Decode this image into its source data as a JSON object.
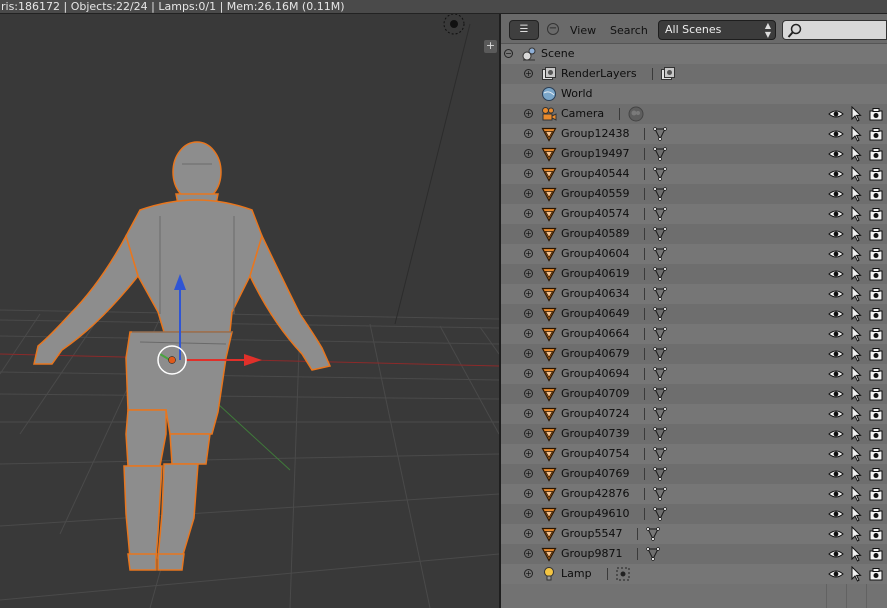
{
  "status_bar": {
    "text": "ris:186172 | Objects:22/24 | Lamps:0/1 | Mem:26.16M (0.11M)"
  },
  "viewport": {
    "plus_label": "+"
  },
  "outliner": {
    "header": {
      "editor_type_label": "☰",
      "collapse_label": "−",
      "view_menu": "View",
      "search_menu": "Search",
      "display_mode": "All Scenes",
      "search_placeholder": ""
    },
    "rows": [
      {
        "label": "Scene",
        "icon": "scene-icon",
        "level": 0,
        "expander": "minus",
        "data_icon": null,
        "restrict": false
      },
      {
        "label": "RenderLayers",
        "icon": "renderlayers-icon",
        "level": 1,
        "expander": "plus",
        "data_icon": "renderlayer-icon",
        "restrict": false
      },
      {
        "label": "World",
        "icon": "world-icon",
        "level": 1,
        "expander": null,
        "data_icon": null,
        "restrict": false
      },
      {
        "label": "Camera",
        "icon": "camera-object-icon",
        "level": 1,
        "expander": "plus",
        "data_icon": "camera-data-icon",
        "restrict": true
      },
      {
        "label": "Group12438",
        "icon": "mesh-object-icon",
        "level": 1,
        "expander": "plus",
        "data_icon": "mesh-data-icon",
        "restrict": true
      },
      {
        "label": "Group19497",
        "icon": "mesh-object-icon",
        "level": 1,
        "expander": "plus",
        "data_icon": "mesh-data-icon",
        "restrict": true
      },
      {
        "label": "Group40544",
        "icon": "mesh-object-icon",
        "level": 1,
        "expander": "plus",
        "data_icon": "mesh-data-icon",
        "restrict": true
      },
      {
        "label": "Group40559",
        "icon": "mesh-object-icon",
        "level": 1,
        "expander": "plus",
        "data_icon": "mesh-data-icon",
        "restrict": true
      },
      {
        "label": "Group40574",
        "icon": "mesh-object-icon",
        "level": 1,
        "expander": "plus",
        "data_icon": "mesh-data-icon",
        "restrict": true
      },
      {
        "label": "Group40589",
        "icon": "mesh-object-icon",
        "level": 1,
        "expander": "plus",
        "data_icon": "mesh-data-icon",
        "restrict": true
      },
      {
        "label": "Group40604",
        "icon": "mesh-object-icon",
        "level": 1,
        "expander": "plus",
        "data_icon": "mesh-data-icon",
        "restrict": true
      },
      {
        "label": "Group40619",
        "icon": "mesh-object-icon",
        "level": 1,
        "expander": "plus",
        "data_icon": "mesh-data-icon",
        "restrict": true
      },
      {
        "label": "Group40634",
        "icon": "mesh-object-icon",
        "level": 1,
        "expander": "plus",
        "data_icon": "mesh-data-icon",
        "restrict": true
      },
      {
        "label": "Group40649",
        "icon": "mesh-object-icon",
        "level": 1,
        "expander": "plus",
        "data_icon": "mesh-data-icon",
        "restrict": true
      },
      {
        "label": "Group40664",
        "icon": "mesh-object-icon",
        "level": 1,
        "expander": "plus",
        "data_icon": "mesh-data-icon",
        "restrict": true
      },
      {
        "label": "Group40679",
        "icon": "mesh-object-icon",
        "level": 1,
        "expander": "plus",
        "data_icon": "mesh-data-icon",
        "restrict": true
      },
      {
        "label": "Group40694",
        "icon": "mesh-object-icon",
        "level": 1,
        "expander": "plus",
        "data_icon": "mesh-data-icon",
        "restrict": true
      },
      {
        "label": "Group40709",
        "icon": "mesh-object-icon",
        "level": 1,
        "expander": "plus",
        "data_icon": "mesh-data-icon",
        "restrict": true
      },
      {
        "label": "Group40724",
        "icon": "mesh-object-icon",
        "level": 1,
        "expander": "plus",
        "data_icon": "mesh-data-icon",
        "restrict": true
      },
      {
        "label": "Group40739",
        "icon": "mesh-object-icon",
        "level": 1,
        "expander": "plus",
        "data_icon": "mesh-data-icon",
        "restrict": true
      },
      {
        "label": "Group40754",
        "icon": "mesh-object-icon",
        "level": 1,
        "expander": "plus",
        "data_icon": "mesh-data-icon",
        "restrict": true
      },
      {
        "label": "Group40769",
        "icon": "mesh-object-icon",
        "level": 1,
        "expander": "plus",
        "data_icon": "mesh-data-icon",
        "restrict": true
      },
      {
        "label": "Group42876",
        "icon": "mesh-object-icon",
        "level": 1,
        "expander": "plus",
        "data_icon": "mesh-data-icon",
        "restrict": true
      },
      {
        "label": "Group49610",
        "icon": "mesh-object-icon",
        "level": 1,
        "expander": "plus",
        "data_icon": "mesh-data-icon",
        "restrict": true
      },
      {
        "label": "Group5547",
        "icon": "mesh-object-icon",
        "level": 1,
        "expander": "plus",
        "data_icon": "mesh-data-icon",
        "restrict": true
      },
      {
        "label": "Group9871",
        "icon": "mesh-object-icon",
        "level": 1,
        "expander": "plus",
        "data_icon": "mesh-data-icon",
        "restrict": true
      },
      {
        "label": "Lamp",
        "icon": "lamp-object-icon",
        "level": 1,
        "expander": "plus",
        "data_icon": "lamp-data-icon",
        "restrict": true
      }
    ]
  },
  "colors": {
    "selection_outline": "#e8761e",
    "mesh_icon": "#e98a2c",
    "x_axis": "#e0302a",
    "y_axis": "#49a33f",
    "z_axis": "#2f55d4"
  }
}
